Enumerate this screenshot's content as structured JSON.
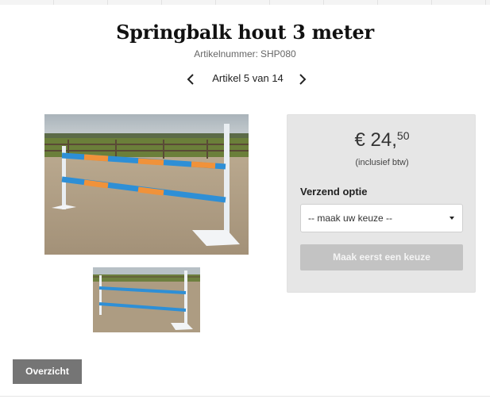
{
  "product": {
    "title": "Springbalk hout 3 meter",
    "sku_label": "Artikelnummer:",
    "sku": "SHP080"
  },
  "pager": {
    "text": "Artikel 5 van 14",
    "prev_icon": "chevron-left-icon",
    "next_icon": "chevron-right-icon"
  },
  "pricing": {
    "currency": "€",
    "whole": "24,",
    "cents": "50",
    "vat_note": "(inclusief btw)"
  },
  "shipping": {
    "label": "Verzend optie",
    "selected": "-- maak uw keuze --"
  },
  "buy_button": {
    "label": "Maak eerst een keuze",
    "enabled": false
  },
  "overview_button": {
    "label": "Overzicht"
  },
  "colors": {
    "panel_bg": "#e6e6e6",
    "button_disabled": "#c3c3c3",
    "button_dark": "#757575",
    "pole_blue": "#2e8fd6",
    "pole_orange": "#f0923a"
  }
}
